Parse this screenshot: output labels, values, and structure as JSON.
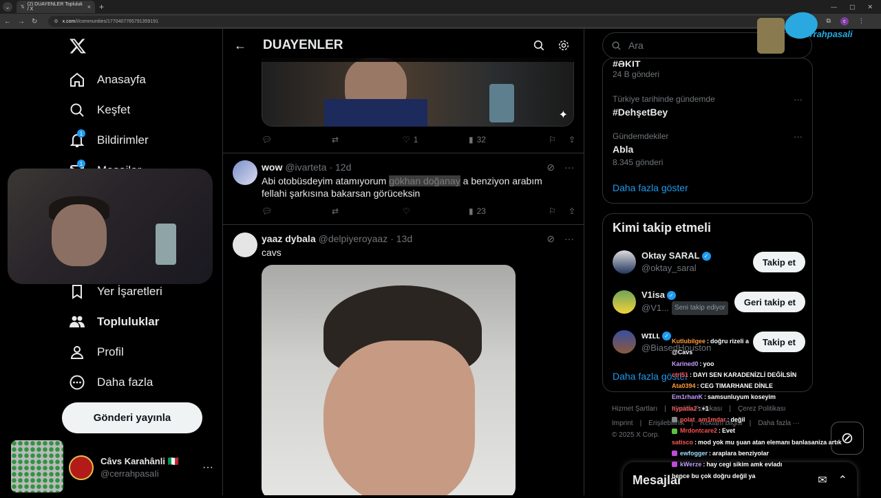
{
  "browser": {
    "tab_title": "(2) DUAYENLER Topluluk / X",
    "url_domain": "x.com",
    "url_path": "/i/communities/1770407765791359191"
  },
  "sidebar": {
    "items": [
      {
        "label": "Anasayfa",
        "icon": "home-icon"
      },
      {
        "label": "Keşfet",
        "icon": "search-icon"
      },
      {
        "label": "Bildirimler",
        "icon": "bell-icon",
        "badge": "1"
      },
      {
        "label": "Mesajlar",
        "icon": "mail-icon",
        "badge": "1"
      },
      {
        "label": "Yer İşaretleri",
        "icon": "bookmark-icon"
      },
      {
        "label": "Topluluklar",
        "icon": "communities-icon"
      },
      {
        "label": "Profil",
        "icon": "person-icon"
      },
      {
        "label": "Daha fazla",
        "icon": "more-circle-icon"
      }
    ],
    "post_button": "Gönderi yayınla",
    "user": {
      "name": "Câvs Karahânli 🇮🇹",
      "handle": "@cerrahpasaIi"
    }
  },
  "main": {
    "title": "DUAYENLER",
    "tweet0": {
      "replies": "",
      "retweets": "",
      "likes": "1",
      "views": "32"
    },
    "tweet1": {
      "name": "wow",
      "handle": "@ivarteta",
      "time": "· 12d",
      "text_pre": "Abi otobüsdeyim atamıyorum ",
      "text_hl": "gökhan doğanay",
      "text_post": " a benziyon arabım fellahi şarkısına bakarsan görüceksin",
      "likes": "",
      "views": "23"
    },
    "tweet2": {
      "name": "yaaz dybala",
      "handle": "@delpiyeroyaaz",
      "time": "· 13d",
      "text": "cavs"
    }
  },
  "right": {
    "search_placeholder": "Ara",
    "trends": [
      {
        "meta": "",
        "title": "#ƏKIT",
        "count": "24 B gönderi"
      },
      {
        "meta": "Türkiye tarihinde gündemde",
        "title": "#DehşetBey",
        "count": ""
      },
      {
        "meta": "Gündemdekiler",
        "title": "Abla",
        "count": "8.345 gönderi"
      }
    ],
    "show_more": "Daha fazla göster",
    "who_title": "Kimi takip etmeli",
    "who": [
      {
        "name": "Oktay SARAL",
        "handle": "@oktay_saral",
        "button": "Takip et",
        "tag": ""
      },
      {
        "name": "V1isa",
        "handle": "@V1...",
        "button": "Geri takip et",
        "tag": "Seni takip ediyor"
      },
      {
        "name": "ᴡɪʟʟ",
        "handle": "@BiasedHouston",
        "button": "Takip et",
        "tag": ""
      }
    ],
    "who_more": "Daha fazla göster",
    "footer1": [
      "Hizmet Şartları",
      "Gizlilik Politikası",
      "Çerez Politikası"
    ],
    "footer2": [
      "Imprint",
      "Erişilebilirlik",
      "Reklam bilgisi",
      "Daha fazla ···"
    ],
    "copyright": "© 2025 X Corp.",
    "messages_title": "Mesajlar"
  },
  "overlay": {
    "logo_text": "cerrahpasali",
    "chat": [
      {
        "user": "Kutlubilgee",
        "color": "#ff9a3c",
        "msg": "doğru rizeli a",
        "badge": ""
      },
      {
        "user": "",
        "color": "#ffffff",
        "msg": "@Cavs",
        "badge": ""
      },
      {
        "user": "Karined0",
        "color": "#c39bff",
        "msg": "yoo",
        "badge": ""
      },
      {
        "user": "ctrl51",
        "color": "#ff5a5a",
        "msg": "DAYI SEN KARADENİZLİ DEĞİLSİN",
        "badge": ""
      },
      {
        "user": "Ata0394",
        "color": "#ff9a3c",
        "msg": "CEG TIMARHANE DİNLE",
        "badge": ""
      },
      {
        "user": "Em1rhanK",
        "color": "#c39bff",
        "msg": "samsunluyum koseyim",
        "badge": ""
      },
      {
        "user": "hypatia2",
        "color": "#ff5a5a",
        "msg": "+1",
        "badge": ""
      },
      {
        "user": "polat_am1mdar",
        "color": "#ff5a5a",
        "msg": "değil",
        "badge": "#888"
      },
      {
        "user": "Mrdontcare2",
        "color": "#ff4d4d",
        "msg": "Evet",
        "badge": "#5fbf3f"
      },
      {
        "user": "satisco",
        "color": "#ff5a5a",
        "msg": "mod yok mu şuan atan elemanı banlasaniza artık",
        "badge": ""
      },
      {
        "user": "ewfogger",
        "color": "#9fdcff",
        "msg": "araplara benziyolar",
        "badge": "#c04bd6"
      },
      {
        "user": "kWerze",
        "color": "#c39bff",
        "msg": "hay cegi sikim amk evladı",
        "badge": "#c04bd6"
      },
      {
        "user": "",
        "color": "#ffffff",
        "msg": "bence bu çok doğru değil ya",
        "badge": ""
      }
    ]
  }
}
